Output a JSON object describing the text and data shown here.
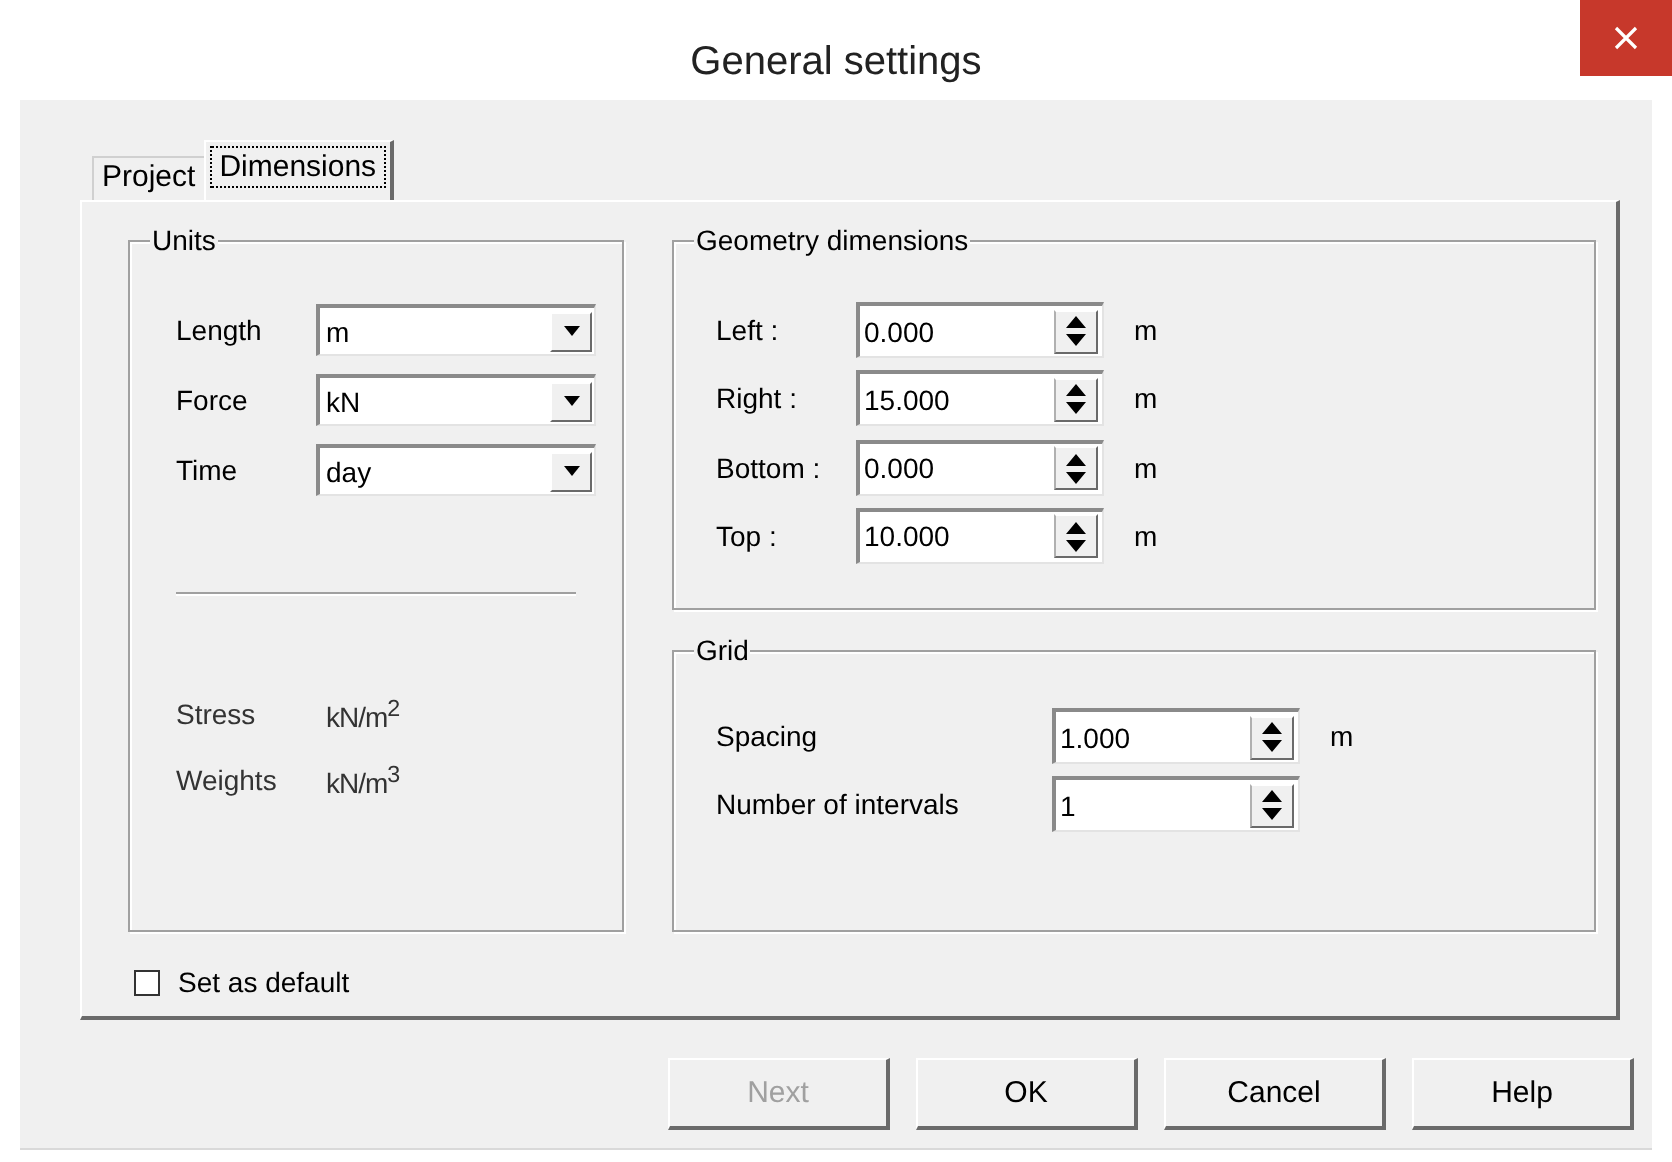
{
  "window": {
    "title": "General settings"
  },
  "tabs": [
    {
      "label": "Project",
      "selected": false
    },
    {
      "label": "Dimensions",
      "selected": true
    }
  ],
  "units": {
    "title": "Units",
    "fields": [
      {
        "label": "Length",
        "value": "m"
      },
      {
        "label": "Force",
        "value": "kN"
      },
      {
        "label": "Time",
        "value": "day"
      }
    ],
    "derived": [
      {
        "label": "Stress",
        "unit": "kN/m$^{2}$"
      },
      {
        "label": "Weights",
        "unit": "kN/m$^{3}$"
      }
    ]
  },
  "geometry": {
    "title": "Geometry dimensions",
    "fields": [
      {
        "label": "Left :",
        "value": "0.000",
        "unit": "m"
      },
      {
        "label": "Right :",
        "value": "15.000",
        "unit": "m"
      },
      {
        "label": "Bottom :",
        "value": "0.000",
        "unit": "m"
      },
      {
        "label": "Top :",
        "value": "10.000",
        "unit": "m"
      }
    ]
  },
  "grid": {
    "title": "Grid",
    "fields": [
      {
        "label": "Spacing",
        "value": "1.000",
        "unit": "m"
      },
      {
        "label": "Number of intervals",
        "value": "1"
      }
    ]
  },
  "set_as_default": {
    "label": "Set as default",
    "checked": false
  },
  "buttons": [
    {
      "label": "Next",
      "disabled": true
    },
    {
      "label": "OK",
      "disabled": false
    },
    {
      "label": "Cancel",
      "disabled": false
    },
    {
      "label": "Help",
      "disabled": false
    }
  ]
}
